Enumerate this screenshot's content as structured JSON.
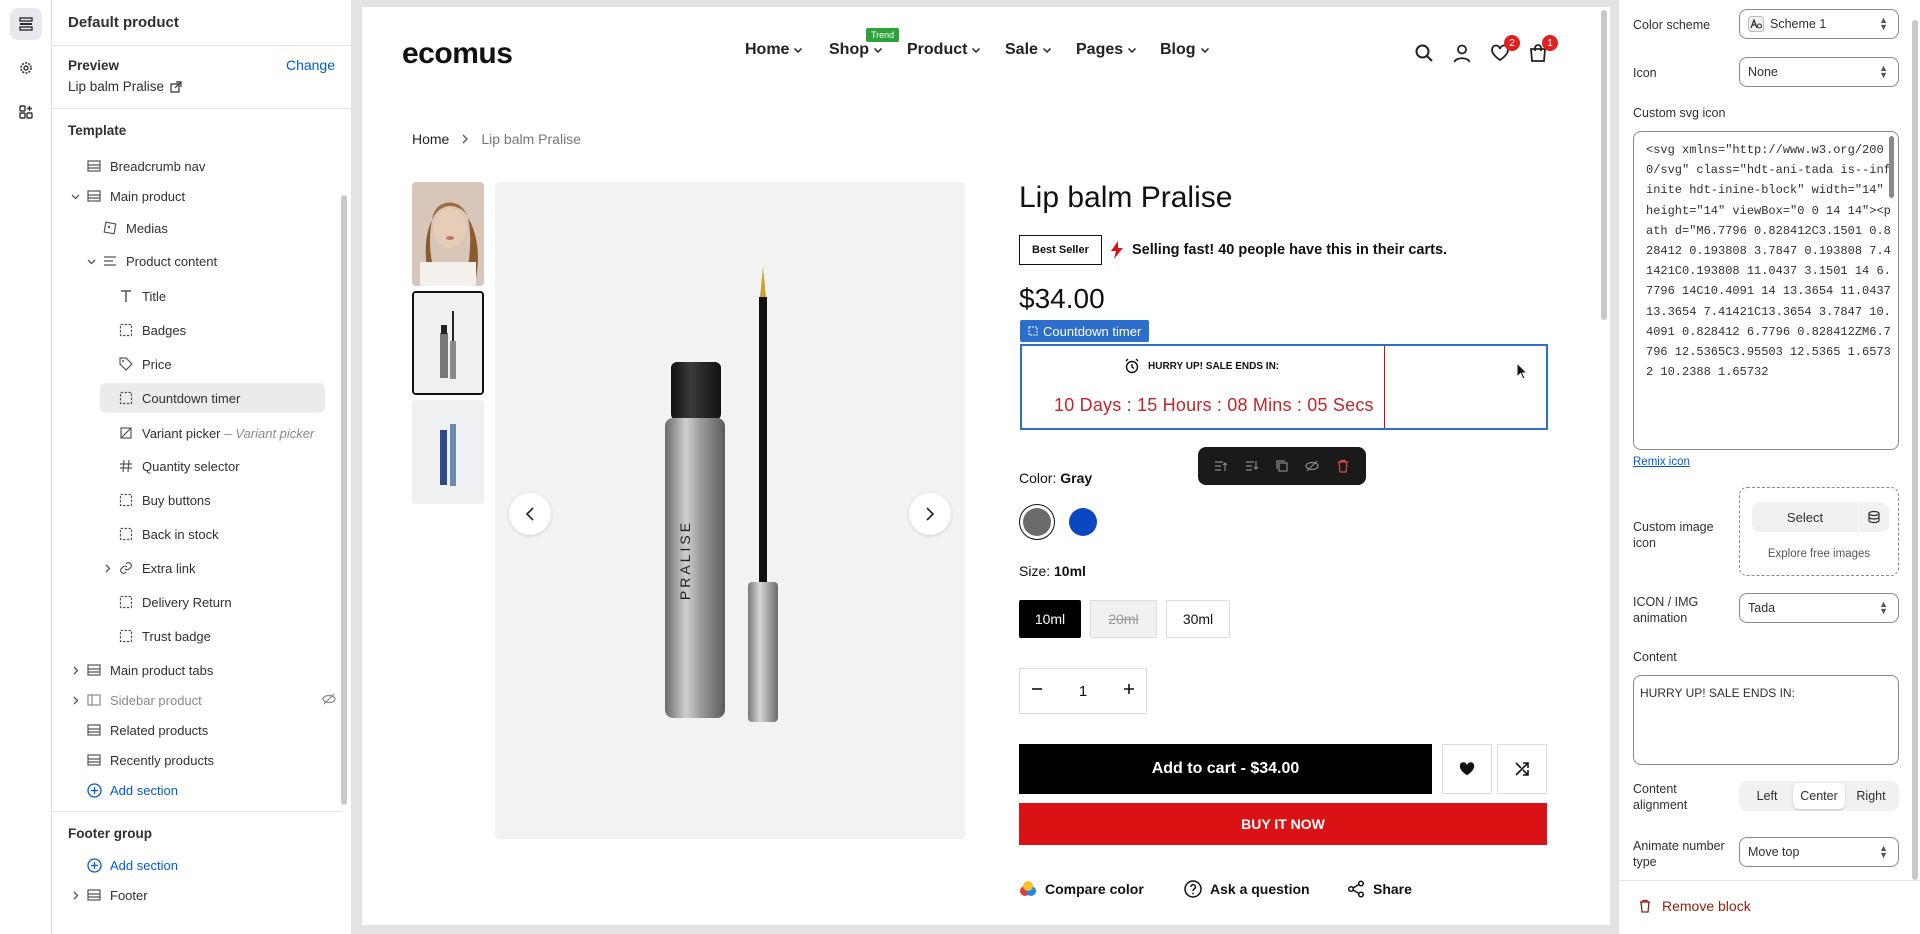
{
  "tree": {
    "title": "Default product",
    "preview_label": "Preview",
    "change_label": "Change",
    "preview_value": "Lip balm Pralise",
    "template_label": "Template",
    "items": [
      {
        "label": "Breadcrumb nav"
      },
      {
        "label": "Main product"
      },
      {
        "label": "Medias"
      },
      {
        "label": "Product content"
      },
      {
        "label": "Title"
      },
      {
        "label": "Badges"
      },
      {
        "label": "Price"
      },
      {
        "label": "Countdown timer"
      },
      {
        "label": "Variant picker",
        "sub": "– Variant picker"
      },
      {
        "label": "Quantity selector"
      },
      {
        "label": "Buy buttons"
      },
      {
        "label": "Back in stock"
      },
      {
        "label": "Extra link"
      },
      {
        "label": "Delivery Return"
      },
      {
        "label": "Trust badge"
      },
      {
        "label": "Main product tabs"
      },
      {
        "label": "Sidebar product"
      },
      {
        "label": "Related products"
      },
      {
        "label": "Recently products"
      },
      {
        "label": "Add section"
      }
    ],
    "footer_group_label": "Footer group",
    "footer_add_section": "Add section",
    "footer_item": "Footer"
  },
  "store": {
    "logo": "ecomus",
    "nav": [
      "Home",
      "Shop",
      "Product",
      "Sale",
      "Pages",
      "Blog"
    ],
    "trend_badge": "Trend",
    "wishlist_count": "2",
    "cart_count": "1",
    "breadcrumb": {
      "home": "Home",
      "current": "Lip balm Pralise"
    },
    "product": {
      "title": "Lip balm Pralise",
      "badge": "Best Seller",
      "selling_fast": "Selling fast! 40 people have this in their carts.",
      "price": "$34.00",
      "color_label": "Color:",
      "color_value": "Gray",
      "size_label": "Size:",
      "size_value": "10ml",
      "sizes": [
        "10ml",
        "20ml",
        "30ml"
      ],
      "quantity": "1",
      "add_to_cart": "Add to cart - $34.00",
      "buy_now": "BUY IT NOW",
      "compare_color": "Compare color",
      "ask_question": "Ask a question",
      "share": "Share",
      "image_text": "PRALISE"
    },
    "countdown": {
      "tag": "Countdown timer",
      "heading": "HURRY UP! SALE ENDS IN:",
      "time": "10 Days :  15 Hours : 08 Mins : 05 Secs"
    }
  },
  "panel": {
    "color_scheme_label": "Color scheme",
    "color_scheme_value": "Scheme 1",
    "icon_label": "Icon",
    "icon_value": "None",
    "custom_svg_label": "Custom svg icon",
    "custom_svg_value": "<svg xmlns=\"http://www.w3.org/2000/svg\" class=\"hdt-ani-tada is--infinite hdt-inine-block\" width=\"14\" height=\"14\" viewBox=\"0 0 14 14\"><path d=\"M6.7796 0.828412C3.1501 0.828412 0.193808 3.7847 0.193808 7.41421C0.193808 11.0437 3.1501 14 6.7796 14C10.4091 14 13.3654 11.0437 13.3654 7.41421C13.3654 3.7847 10.4091 0.828412 6.7796 0.828412ZM6.7796 12.5365C3.95503 12.5365 1.65732 10.2388 1.65732",
    "remix_link": "Remix icon",
    "custom_image_label": "Custom image icon",
    "select_label": "Select",
    "explore_label": "Explore free images",
    "animation_label": "ICON / IMG animation",
    "animation_value": "Tada",
    "content_label": "Content",
    "content_value": "HURRY UP! SALE ENDS IN:",
    "alignment_label": "Content alignment",
    "alignment_options": [
      "Left",
      "Center",
      "Right"
    ],
    "animate_label": "Animate number type",
    "animate_value": "Move top",
    "remove_block": "Remove block"
  },
  "colors": {
    "accent": "#2c6ecb",
    "sale_red": "#db1215",
    "countdown_red": "#c0262b",
    "link": "#005bd3"
  }
}
